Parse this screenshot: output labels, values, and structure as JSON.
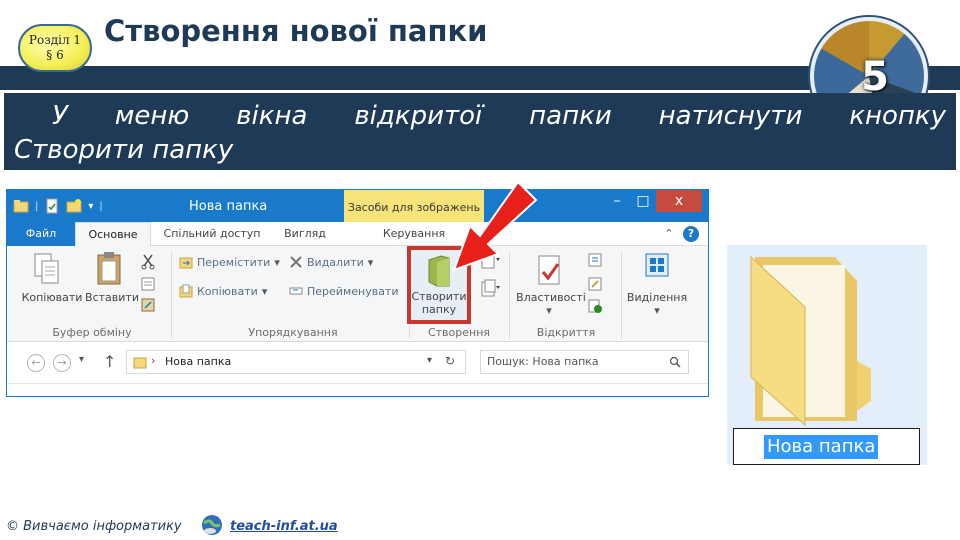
{
  "slide": {
    "section_line1": "Розділ 1",
    "section_line2": "§ 6",
    "title": "Створення нової папки",
    "logo_number": "5",
    "instruction_line1": "У меню вікна відкритої папки натиснути кнопку",
    "instruction_line2": "Створити папку"
  },
  "window": {
    "title": "Нова папка",
    "contextual_tab": "Засоби для зображень",
    "controls": {
      "minimize": "–",
      "maximize": "□",
      "close": "x"
    },
    "tabs": [
      "Файл",
      "Основне",
      "Спільний доступ",
      "Вигляд",
      "Керування"
    ],
    "help": "?",
    "ribbon": {
      "clipboard": {
        "copy": "Копіювати",
        "paste": "Вставити",
        "label": "Буфер обміну"
      },
      "organize": {
        "move": "Перемістити",
        "copy_to": "Копіювати",
        "delete": "Видалити",
        "rename": "Перейменувати",
        "label": "Упорядкування"
      },
      "new": {
        "create_line1": "Створити",
        "create_line2": "папку",
        "label": "Створення"
      },
      "open": {
        "properties": "Властивості",
        "label": "Відкриття"
      },
      "select": {
        "selection": "Виділення"
      }
    },
    "address": {
      "path": "Нова папка",
      "search_placeholder": "Пошук: Нова папка"
    }
  },
  "folder_preview": {
    "label": "Нова папка"
  },
  "footer": {
    "copyright": "© Вивчаємо інформатику",
    "link": "teach-inf.at.ua"
  },
  "colors": {
    "header_dark": "#1f3a57",
    "window_blue": "#1979ca",
    "arrow_red": "#e8201a",
    "highlight_red": "#c9382f",
    "selection_blue": "#3399ff",
    "folder_yellow": "#f3d77a"
  },
  "icons": [
    "qa-folder-icon",
    "qa-properties-icon",
    "qa-new-folder-icon",
    "new-folder-icon",
    "copy-icon",
    "paste-icon",
    "cut-icon",
    "move-icon",
    "delete-icon",
    "rename-icon",
    "properties-icon",
    "select-icon",
    "back-icon",
    "forward-icon",
    "up-icon",
    "refresh-icon",
    "search-icon",
    "globe-icon",
    "folder-icon"
  ]
}
